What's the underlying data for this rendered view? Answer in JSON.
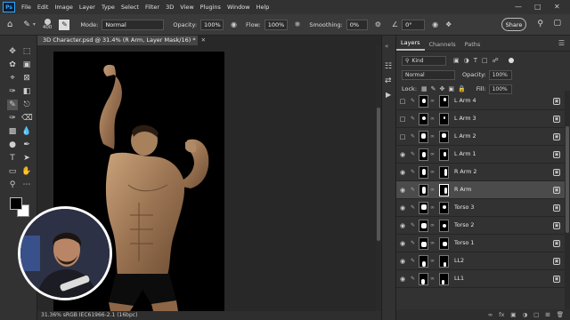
{
  "menubar": {
    "logo": "Ps",
    "items": [
      "File",
      "Edit",
      "Image",
      "Layer",
      "Type",
      "Select",
      "Filter",
      "3D",
      "View",
      "Plugins",
      "Window",
      "Help"
    ]
  },
  "options": {
    "brush_size": "400",
    "mode_label": "Mode:",
    "mode_value": "Normal",
    "opacity_label": "Opacity:",
    "opacity_value": "100%",
    "flow_label": "Flow:",
    "flow_value": "100%",
    "smoothing_label": "Smoothing:",
    "smoothing_value": "0%",
    "angle_value": "0°",
    "share_label": "Share"
  },
  "document": {
    "tab_title": "3D Character.psd @ 31.4% (R Arm, Layer Mask/16) *",
    "status": "31.36%   sRGB IEC61966-2.1 (16bpc)"
  },
  "panel": {
    "tabs": [
      "Layers",
      "Channels",
      "Paths"
    ],
    "kind_label": "Kind",
    "blend_mode": "Normal",
    "opacity_label": "Opacity:",
    "opacity_value": "100%",
    "lock_label": "Lock:",
    "fill_label": "Fill:",
    "fill_value": "100%",
    "layers": [
      {
        "name": "L Arm 4",
        "visible": false,
        "selected": false
      },
      {
        "name": "L Arm 3",
        "visible": false,
        "selected": false
      },
      {
        "name": "L Arm 2",
        "visible": false,
        "selected": false
      },
      {
        "name": "L Arm 1",
        "visible": true,
        "selected": false
      },
      {
        "name": "R Arm 2",
        "visible": true,
        "selected": false
      },
      {
        "name": "R Arm",
        "visible": true,
        "selected": true
      },
      {
        "name": "Torso 3",
        "visible": true,
        "selected": false
      },
      {
        "name": "Torso 2",
        "visible": true,
        "selected": false
      },
      {
        "name": "Torso 1",
        "visible": true,
        "selected": false
      },
      {
        "name": "LL2",
        "visible": true,
        "selected": false
      },
      {
        "name": "LL1",
        "visible": true,
        "selected": false
      }
    ],
    "footer_icons": [
      "link-icon",
      "fx-icon",
      "mask-icon",
      "adjustment-icon",
      "group-icon",
      "new-layer-icon",
      "trash-icon"
    ]
  },
  "colors": {
    "accent": "#31a8ff",
    "app_bg": "#323232",
    "canvas_bg": "#000000",
    "selected_layer": "#4b4b4b"
  }
}
